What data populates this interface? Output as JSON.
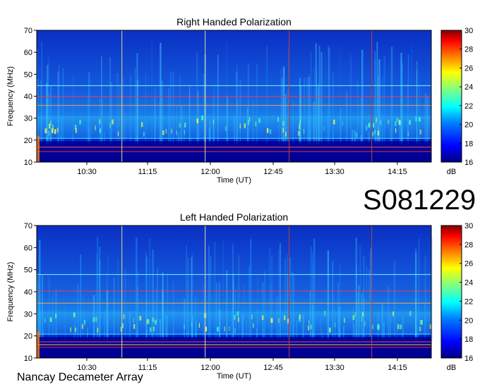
{
  "observation_id": "S081229",
  "footer": "Nancay Decameter Array",
  "colors": {
    "background": "#00008b",
    "scale": [
      "#00007f",
      "#0000ff",
      "#0080ff",
      "#00ffff",
      "#80ff80",
      "#ffff00",
      "#ff8000",
      "#ff0000",
      "#7f0000"
    ]
  },
  "chart_data": [
    {
      "type": "heatmap",
      "title": "Right Handed Polarization",
      "xlabel": "Time (UT)",
      "ylabel": "Frequency (MHz)",
      "x_ticks": [
        "10:30",
        "11:15",
        "12:00",
        "12:45",
        "13:30",
        "14:15"
      ],
      "y_ticks": [
        10,
        20,
        30,
        40,
        50,
        60,
        70
      ],
      "ylim": [
        10,
        70
      ],
      "colorbar": {
        "label": "dB",
        "ticks": [
          16,
          18,
          20,
          22,
          24,
          26,
          28,
          30
        ],
        "range": [
          16,
          30
        ]
      }
    },
    {
      "type": "heatmap",
      "title": "Left Handed Polarization",
      "xlabel": "Time (UT)",
      "ylabel": "Frequency (MHz)",
      "x_ticks": [
        "10:30",
        "11:15",
        "12:00",
        "12:45",
        "13:30",
        "14:15"
      ],
      "y_ticks": [
        10,
        20,
        30,
        40,
        50,
        60,
        70
      ],
      "ylim": [
        10,
        70
      ],
      "colorbar": {
        "label": "dB",
        "ticks": [
          16,
          18,
          20,
          22,
          24,
          26,
          28,
          30
        ],
        "range": [
          16,
          30
        ]
      }
    }
  ]
}
